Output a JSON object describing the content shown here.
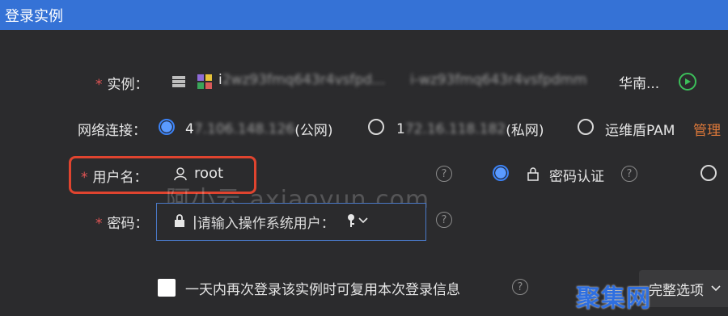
{
  "window": {
    "title": "登录实例"
  },
  "instance": {
    "label": "实例：",
    "id_prefix": "i",
    "id_blurred": "2wz93fmq643r4vsfpd...",
    "id2_blurred": "i-wz93fmq643r4vsfpdmm",
    "region": "华南..."
  },
  "network": {
    "label": "网络连接：",
    "option_public_prefix": "4",
    "option_public_blur": "7.106.148.126",
    "option_public_suffix": "(公网)",
    "option_private_prefix": "1",
    "option_private_blur": "72.16.118.182",
    "option_private_suffix": "(私网)",
    "option_pam": "运维盾PAM",
    "manage_link": "管理"
  },
  "user": {
    "label": "用户名：",
    "value": "root",
    "auth_password": "密码认证"
  },
  "password": {
    "label": "密码：",
    "placeholder": "请输入操作系统用户：",
    "cursor": "|"
  },
  "remember": {
    "text": "一天内再次登录该实例时可复用本次登录信息"
  },
  "complete_options": {
    "label": "完整选项"
  },
  "watermarks": {
    "center": "阿小云 axiaoyun.com",
    "corner": "聚集网"
  },
  "help_symbol": "?"
}
